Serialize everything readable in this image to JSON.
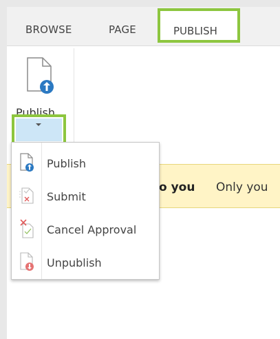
{
  "tabs": {
    "browse": "BROWSE",
    "page": "PAGE",
    "publish": "PUBLISH"
  },
  "ribbon": {
    "publish_label": "Publish"
  },
  "banner": {
    "bold_text": "o you",
    "text": "Only you"
  },
  "menu": {
    "items": [
      {
        "label": "Publish",
        "icon": "publish-icon"
      },
      {
        "label": "Submit",
        "icon": "submit-icon"
      },
      {
        "label": "Cancel Approval",
        "icon": "cancel-approval-icon"
      },
      {
        "label": "Unpublish",
        "icon": "unpublish-icon"
      }
    ]
  },
  "colors": {
    "highlight": "#8dc63f",
    "accent_blue": "#2b79c2",
    "banner_bg": "#fff4c6",
    "danger_red": "#e05a5a"
  }
}
